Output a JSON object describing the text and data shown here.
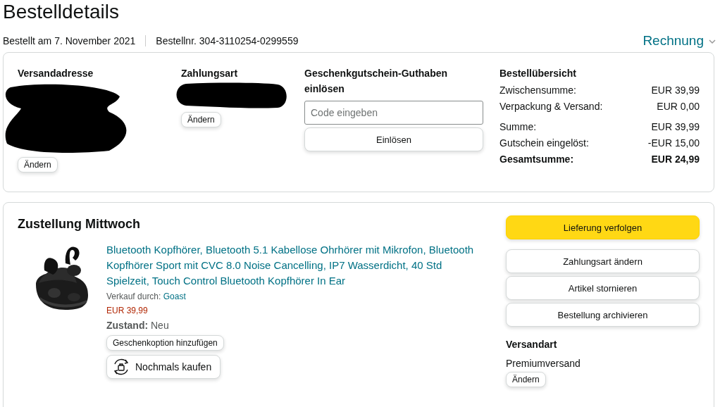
{
  "page": {
    "title": "Bestelldetails",
    "ordered": "Bestellt am 7. November 2021",
    "order_number": "Bestellnr. 304-3110254-0299559",
    "invoice_link": "Rechnung"
  },
  "summary_card": {
    "shipping_address": {
      "heading": "Versandadresse",
      "button": "Ändern"
    },
    "payment": {
      "heading": "Zahlungsart",
      "button": "Ändern"
    },
    "gift_card": {
      "heading": "Geschenkgutschein-Guthaben einlösen",
      "placeholder": "Code eingeben",
      "button": "Einlösen"
    },
    "overview": {
      "heading": "Bestellübersicht",
      "groups": [
        [
          {
            "label": "Zwischensumme:",
            "value": "EUR 39,99",
            "kind": "line"
          },
          {
            "label": "Verpackung & Versand:",
            "value": "EUR 0,00",
            "kind": "line"
          }
        ],
        [
          {
            "label": "Summe:",
            "value": "EUR 39,99",
            "kind": "line"
          },
          {
            "label": "Gutschein eingelöst:",
            "value": "-EUR 15,00",
            "kind": "line"
          },
          {
            "label": "Gesamtsumme:",
            "value": "EUR 24,99",
            "kind": "total"
          }
        ]
      ]
    }
  },
  "shipment": {
    "heading": "Zustellung Mittwoch",
    "item": {
      "kind": "picture",
      "title": "Bluetooth Kopfhörer, Bluetooth 5.1 Kabellose Ohrhörer mit Mikrofon, Bluetooth Kopfhörer Sport mit CVC 8.0 Noise Cancelling, IP7 Wasserdicht, 40 Std Spielzeit, Touch Control Bluetooth Kopfhörer In Ear",
      "seller_label": "Verkauf durch:",
      "seller": "Goast",
      "price": "EUR 39,99",
      "condition": "**Zustand:** Neu",
      "buttons": [
        {
          "label": "Geschenkoption hinzufügen",
          "kind": "plain"
        },
        {
          "label": "Nochmals kaufen",
          "kind": "buy-again"
        }
      ]
    },
    "actions": [
      {
        "label": "Lieferung verfolgen",
        "kind": "primary"
      },
      {
        "label": "Zahlungsart ändern",
        "kind": "secondary"
      },
      {
        "label": "Artikel stornieren",
        "kind": "secondary"
      },
      {
        "label": "Bestellung archivieren",
        "kind": "secondary"
      }
    ],
    "shipping_method": {
      "heading": "Versandart",
      "value": "Premiumversand",
      "button": "Ändern"
    }
  }
}
